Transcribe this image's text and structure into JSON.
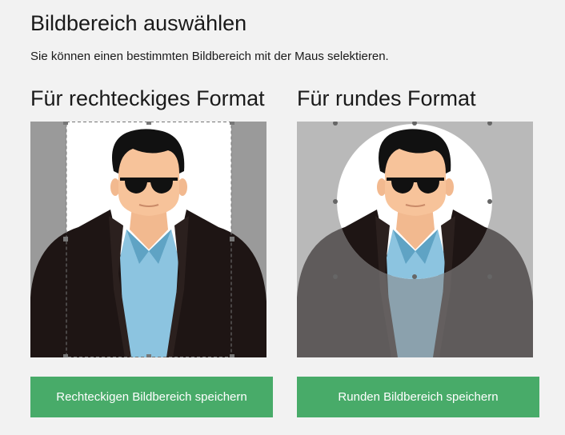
{
  "header": {
    "title": "Bildbereich auswählen",
    "subtitle": "Sie können einen bestimmten Bildbereich mit der Maus selektieren."
  },
  "rect_section": {
    "title": "Für rechteckiges Format",
    "save_label": "Rechteckigen Bildbereich speichern"
  },
  "round_section": {
    "title": "Für rundes Format",
    "save_label": "Runden Bildbereich speichern"
  },
  "colors": {
    "page_background": "#f2f2f2",
    "image_background": "#9a9a9a",
    "button_green": "#48ab69",
    "button_text": "#ffffff"
  },
  "icons": [
    "crop-handle-icon",
    "portrait-image"
  ]
}
